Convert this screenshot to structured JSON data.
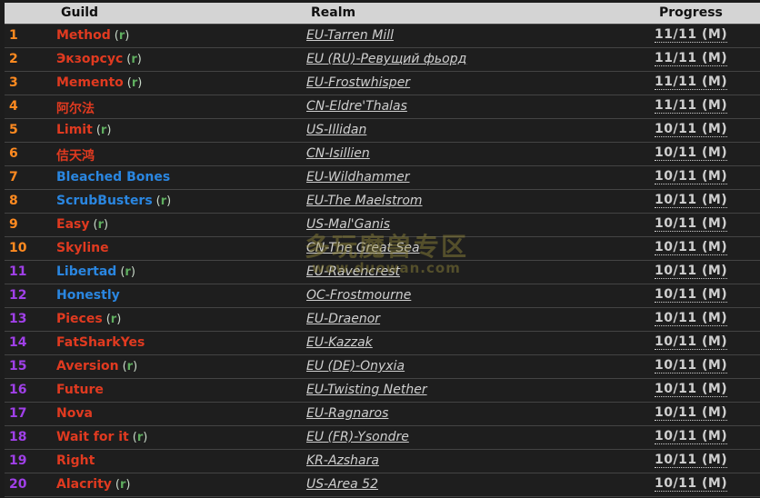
{
  "header": {
    "guild": "Guild",
    "realm": "Realm",
    "progress": "Progress"
  },
  "colors": {
    "rank_top10": "#ff8a20",
    "rank_rest": "#a040e8",
    "guild_red": "#e03a20",
    "guild_blue": "#2a86e0"
  },
  "recruit_label": "r",
  "rows": [
    {
      "rank": "1",
      "guild": "Method",
      "recruiting": true,
      "color": "red",
      "realm": "EU-Tarren Mill",
      "progress": "11/11 (M)"
    },
    {
      "rank": "2",
      "guild": "Экзорсус",
      "recruiting": true,
      "color": "red",
      "realm": "EU (RU)-Ревущий фьорд",
      "progress": "11/11 (M)"
    },
    {
      "rank": "3",
      "guild": "Memento",
      "recruiting": true,
      "color": "red",
      "realm": "EU-Frostwhisper",
      "progress": "11/11 (M)"
    },
    {
      "rank": "4",
      "guild": "阿尔法",
      "recruiting": false,
      "color": "red",
      "realm": "CN-Eldre'Thalas",
      "progress": "11/11 (M)"
    },
    {
      "rank": "5",
      "guild": "Limit",
      "recruiting": true,
      "color": "red",
      "realm": "US-Illidan",
      "progress": "10/11 (M)"
    },
    {
      "rank": "6",
      "guild": "佶天鸿",
      "recruiting": false,
      "color": "red",
      "realm": "CN-Isillien",
      "progress": "10/11 (M)"
    },
    {
      "rank": "7",
      "guild": "Bleached Bones",
      "recruiting": false,
      "color": "blue",
      "realm": "EU-Wildhammer",
      "progress": "10/11 (M)"
    },
    {
      "rank": "8",
      "guild": "ScrubBusters",
      "recruiting": true,
      "color": "blue",
      "realm": "EU-The Maelstrom",
      "progress": "10/11 (M)"
    },
    {
      "rank": "9",
      "guild": "Easy",
      "recruiting": true,
      "color": "red",
      "realm": "US-Mal'Ganis",
      "progress": "10/11 (M)"
    },
    {
      "rank": "10",
      "guild": "Skyline",
      "recruiting": false,
      "color": "red",
      "realm": "CN-The Great Sea",
      "progress": "10/11 (M)"
    },
    {
      "rank": "11",
      "guild": "Libertad",
      "recruiting": true,
      "color": "blue",
      "realm": "EU-Ravencrest",
      "progress": "10/11 (M)"
    },
    {
      "rank": "12",
      "guild": "Honestly",
      "recruiting": false,
      "color": "blue",
      "realm": "OC-Frostmourne",
      "progress": "10/11 (M)"
    },
    {
      "rank": "13",
      "guild": "Pieces",
      "recruiting": true,
      "color": "red",
      "realm": "EU-Draenor",
      "progress": "10/11 (M)"
    },
    {
      "rank": "14",
      "guild": "FatSharkYes",
      "recruiting": false,
      "color": "red",
      "realm": "EU-Kazzak",
      "progress": "10/11 (M)"
    },
    {
      "rank": "15",
      "guild": "Aversion",
      "recruiting": true,
      "color": "red",
      "realm": "EU (DE)-Onyxia",
      "progress": "10/11 (M)"
    },
    {
      "rank": "16",
      "guild": "Future",
      "recruiting": false,
      "color": "red",
      "realm": "EU-Twisting Nether",
      "progress": "10/11 (M)"
    },
    {
      "rank": "17",
      "guild": "Nova",
      "recruiting": false,
      "color": "red",
      "realm": "EU-Ragnaros",
      "progress": "10/11 (M)"
    },
    {
      "rank": "18",
      "guild": "Wait for it",
      "recruiting": true,
      "color": "red",
      "realm": "EU (FR)-Ysondre",
      "progress": "10/11 (M)"
    },
    {
      "rank": "19",
      "guild": "Right",
      "recruiting": false,
      "color": "red",
      "realm": "KR-Azshara",
      "progress": "10/11 (M)"
    },
    {
      "rank": "20",
      "guild": "Alacrity",
      "recruiting": true,
      "color": "red",
      "realm": "US-Area 52",
      "progress": "10/11 (M)"
    }
  ],
  "watermark": {
    "line1": "多玩魔兽专区",
    "line2": "wow.duowan.com"
  }
}
